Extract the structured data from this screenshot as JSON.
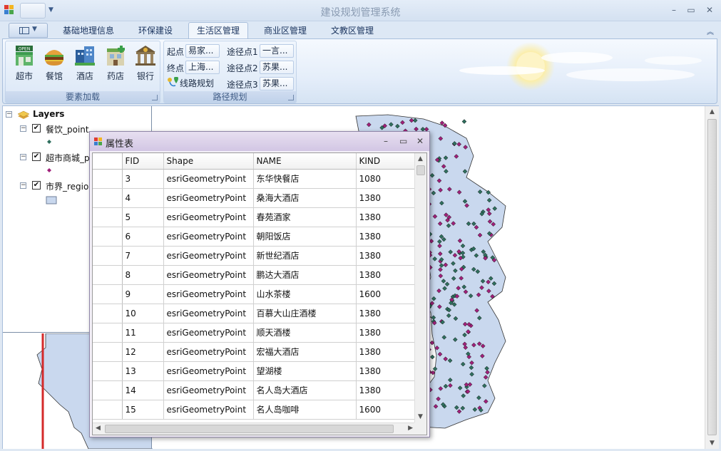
{
  "window": {
    "title": "建设规划管理系统",
    "minimize": "–",
    "maximize": "▭",
    "close": "✕"
  },
  "ribbon_tabs": [
    {
      "label": "基础地理信息",
      "active": false
    },
    {
      "label": "环保建设",
      "active": false
    },
    {
      "label": "生活区管理",
      "active": true
    },
    {
      "label": "商业区管理",
      "active": false
    },
    {
      "label": "文教区管理",
      "active": false
    }
  ],
  "group_layers": {
    "label": "要素加载",
    "buttons": [
      {
        "label": "超市",
        "icon": "shop-icon"
      },
      {
        "label": "餐馆",
        "icon": "burger-icon"
      },
      {
        "label": "酒店",
        "icon": "hotel-icon"
      },
      {
        "label": "药店",
        "icon": "pharmacy-icon"
      },
      {
        "label": "银行",
        "icon": "bank-icon"
      }
    ]
  },
  "group_route": {
    "label": "路径规划",
    "start_label": "起点",
    "start_value": "易家...",
    "end_label": "终点",
    "end_value": "上海...",
    "plan_label": "线路规划",
    "via1_label": "途径点1",
    "via1_value": "一言...",
    "via2_label": "途径点2",
    "via2_value": "苏果...",
    "via3_label": "途径点3",
    "via3_value": "苏果..."
  },
  "toc": {
    "root": "Layers",
    "layers": [
      {
        "name": "餐饮_point",
        "symbol_color": "#2f6f5e"
      },
      {
        "name": "超市商城_p",
        "symbol_color": "#a0207a"
      },
      {
        "name": "市界_regio",
        "symbol_color": "#c9d8ee"
      }
    ]
  },
  "attribute_table": {
    "title": "属性表",
    "columns": [
      "FID",
      "Shape",
      "NAME",
      "KIND"
    ],
    "rows": [
      [
        "3",
        "esriGeometryPoint",
        "东华快餐店",
        "1080"
      ],
      [
        "4",
        "esriGeometryPoint",
        "桑海大酒店",
        "1380"
      ],
      [
        "5",
        "esriGeometryPoint",
        "春苑酒家",
        "1380"
      ],
      [
        "6",
        "esriGeometryPoint",
        "朝阳饭店",
        "1380"
      ],
      [
        "7",
        "esriGeometryPoint",
        "新世纪酒店",
        "1380"
      ],
      [
        "8",
        "esriGeometryPoint",
        "鹏达大酒店",
        "1380"
      ],
      [
        "9",
        "esriGeometryPoint",
        "山水茶楼",
        "1600"
      ],
      [
        "10",
        "esriGeometryPoint",
        "百慕大山庄酒楼",
        "1380"
      ],
      [
        "11",
        "esriGeometryPoint",
        "顺天酒楼",
        "1380"
      ],
      [
        "12",
        "esriGeometryPoint",
        "宏福大酒店",
        "1380"
      ],
      [
        "13",
        "esriGeometryPoint",
        "望湖楼",
        "1380"
      ],
      [
        "14",
        "esriGeometryPoint",
        "名人岛大酒店",
        "1380"
      ],
      [
        "15",
        "esriGeometryPoint",
        "名人岛咖啡",
        "1600"
      ]
    ]
  },
  "colors": {
    "restaurant_point": "#2f6f5e",
    "market_point": "#a0207a",
    "region_fill": "#c9d8ee",
    "boundary_line": "#d42a2a"
  }
}
